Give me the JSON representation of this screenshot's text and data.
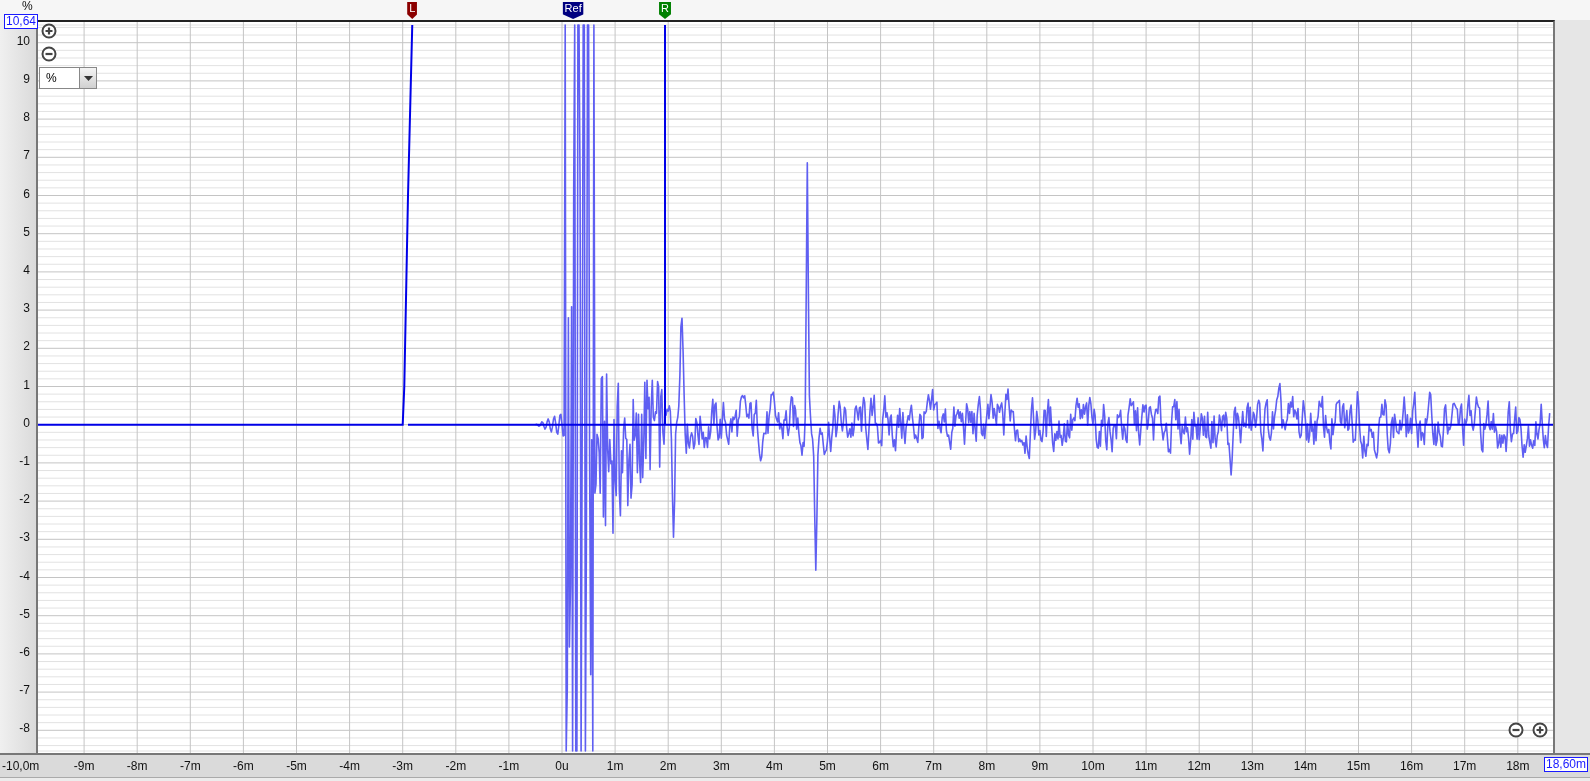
{
  "chart": {
    "unit_label": "%",
    "y_top_value": "10,64",
    "y_ticks": [
      "10",
      "9",
      "8",
      "7",
      "6",
      "5",
      "4",
      "3",
      "2",
      "1",
      "0",
      "-1",
      "-2",
      "-3",
      "-4",
      "-5",
      "-6",
      "-7",
      "-8"
    ],
    "x_ticks": [
      "-10,0m",
      "-9m",
      "-8m",
      "-7m",
      "-6m",
      "-5m",
      "-4m",
      "-3m",
      "-2m",
      "-1m",
      "0u",
      "1m",
      "2m",
      "3m",
      "4m",
      "5m",
      "6m",
      "7m",
      "8m",
      "9m",
      "10m",
      "11m",
      "12m",
      "13m",
      "14m",
      "15m",
      "16m",
      "17m",
      "18m"
    ],
    "x_end_value": "18,60m",
    "markers": [
      {
        "label": "L",
        "color": "#8b0000"
      },
      {
        "label": "Ref",
        "color": "#000080"
      },
      {
        "label": "R",
        "color": "#008000"
      }
    ],
    "unit_select": {
      "value": "%"
    }
  }
}
